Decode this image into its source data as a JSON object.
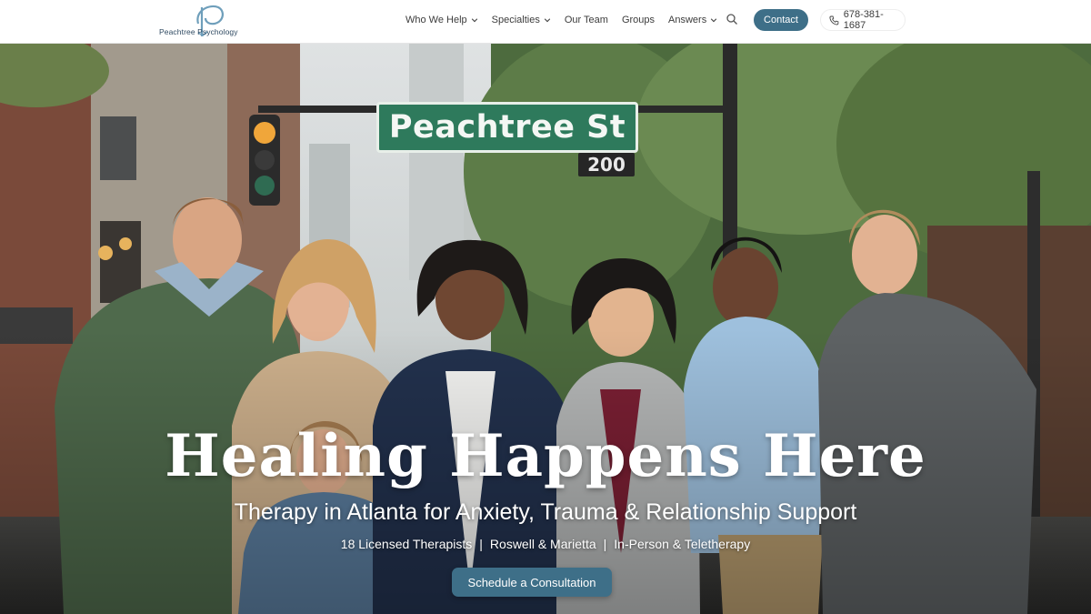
{
  "brand": {
    "logo_text": "Peachtree Psychology"
  },
  "nav": {
    "items": [
      {
        "label": "Who We Help",
        "has_dropdown": true
      },
      {
        "label": "Specialties",
        "has_dropdown": true
      },
      {
        "label": "Our Team",
        "has_dropdown": false
      },
      {
        "label": "Groups",
        "has_dropdown": false
      },
      {
        "label": "Answers",
        "has_dropdown": true
      }
    ],
    "search_icon": "search-icon",
    "contact_label": "Contact",
    "phone": "678-381-1687",
    "phone_icon": "phone-icon"
  },
  "hero": {
    "street_sign": "Peachtree St",
    "block_number": "200",
    "title": "Healing Happens Here",
    "subtitle": "Therapy in Atlanta for Anxiety, Trauma & Relationship Support",
    "meta": [
      "18 Licensed Therapists",
      "Roswell & Marietta",
      "In-Person & Teletherapy"
    ],
    "meta_separator": "|",
    "cta_label": "Schedule a Consultation"
  },
  "colors": {
    "accent": "#3e6f88",
    "logo": "#6f9fbb",
    "sign_green": "#2e7a5c"
  }
}
